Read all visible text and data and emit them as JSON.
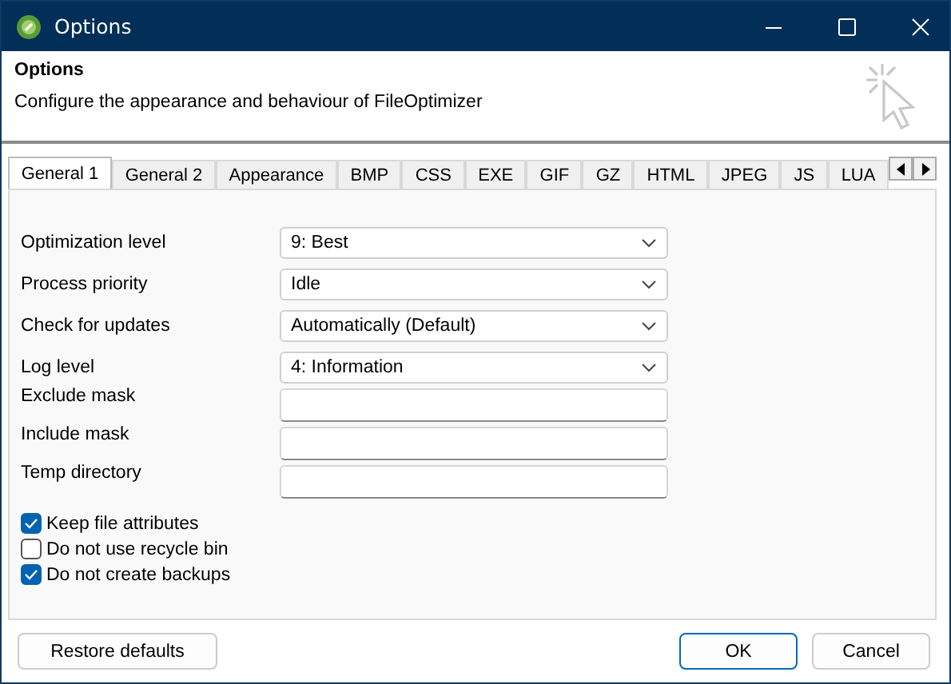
{
  "window": {
    "title": "Options"
  },
  "header": {
    "title": "Options",
    "description": "Configure the appearance and behaviour of FileOptimizer"
  },
  "tabs": [
    {
      "label": "General 1",
      "selected": true
    },
    {
      "label": "General 2",
      "selected": false
    },
    {
      "label": "Appearance",
      "selected": false
    },
    {
      "label": "BMP",
      "selected": false
    },
    {
      "label": "CSS",
      "selected": false
    },
    {
      "label": "EXE",
      "selected": false
    },
    {
      "label": "GIF",
      "selected": false
    },
    {
      "label": "GZ",
      "selected": false
    },
    {
      "label": "HTML",
      "selected": false
    },
    {
      "label": "JPEG",
      "selected": false
    },
    {
      "label": "JS",
      "selected": false
    },
    {
      "label": "LUA",
      "selected": false
    }
  ],
  "fields": [
    {
      "kind": "dropdown",
      "label": "Optimization level",
      "value": "9: Best"
    },
    {
      "kind": "dropdown",
      "label": "Process priority",
      "value": "Idle"
    },
    {
      "kind": "dropdown",
      "label": "Check for updates",
      "value": "Automatically (Default)"
    },
    {
      "kind": "dropdown",
      "label": "Log level",
      "value": "4: Information"
    },
    {
      "kind": "text",
      "label": "Exclude mask"
    },
    {
      "kind": "text",
      "label": "Include mask"
    },
    {
      "kind": "text",
      "label": "Temp directory"
    }
  ],
  "checkboxes": [
    {
      "label": "Keep file attributes",
      "checked": true
    },
    {
      "label": "Do not use recycle bin",
      "checked": false
    },
    {
      "label": "Do not create backups",
      "checked": true
    }
  ],
  "buttons": [
    {
      "label": "Restore defaults",
      "default": false
    },
    {
      "label": "OK",
      "default": true
    },
    {
      "label": "Cancel",
      "default": false
    }
  ]
}
